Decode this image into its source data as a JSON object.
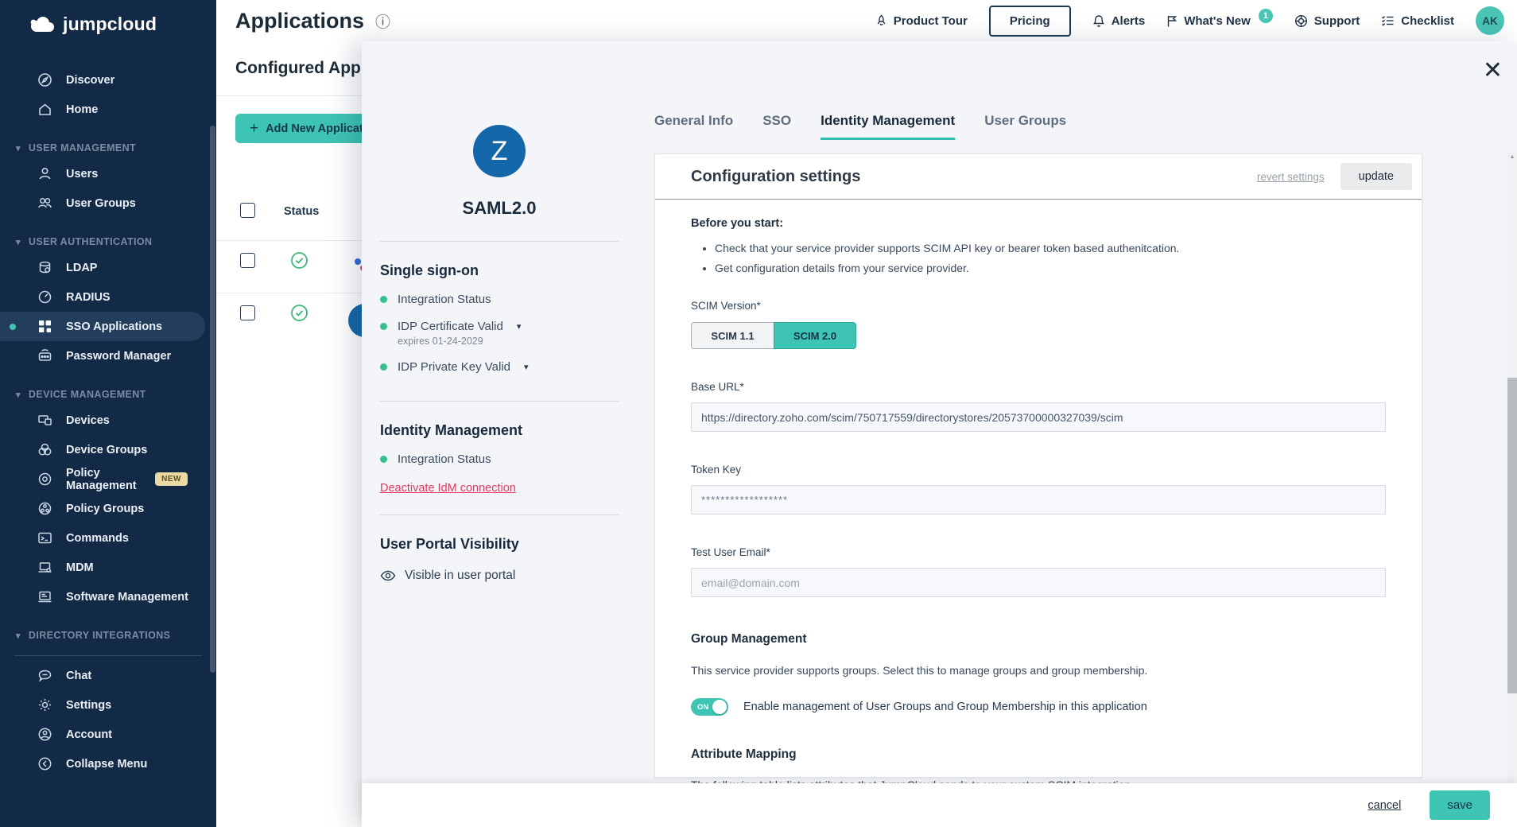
{
  "brand": {
    "name": "jumpcloud"
  },
  "topbar": {
    "title": "Applications",
    "product_tour": "Product Tour",
    "pricing": "Pricing",
    "alerts": "Alerts",
    "whats_new": "What's New",
    "whats_new_badge": "1",
    "support": "Support",
    "checklist": "Checklist",
    "avatar_initials": "AK"
  },
  "sidebar": {
    "top_items": [
      {
        "label": "Discover"
      },
      {
        "label": "Home"
      }
    ],
    "sections": [
      {
        "title": "USER MANAGEMENT",
        "items": [
          {
            "label": "Users"
          },
          {
            "label": "User Groups"
          }
        ]
      },
      {
        "title": "USER AUTHENTICATION",
        "items": [
          {
            "label": "LDAP"
          },
          {
            "label": "RADIUS"
          },
          {
            "label": "SSO Applications"
          },
          {
            "label": "Password Manager"
          }
        ]
      },
      {
        "title": "DEVICE MANAGEMENT",
        "items": [
          {
            "label": "Devices"
          },
          {
            "label": "Device Groups"
          },
          {
            "label": "Policy Management",
            "badge": "NEW"
          },
          {
            "label": "Policy Groups"
          },
          {
            "label": "Commands"
          },
          {
            "label": "MDM"
          },
          {
            "label": "Software Management"
          }
        ]
      },
      {
        "title": "DIRECTORY INTEGRATIONS",
        "items": []
      }
    ],
    "footer_items": [
      {
        "label": "Chat"
      },
      {
        "label": "Settings"
      },
      {
        "label": "Account"
      },
      {
        "label": "Collapse Menu"
      }
    ]
  },
  "page": {
    "heading": "Configured Applications",
    "add_button": "Add New Application",
    "status_header": "Status"
  },
  "drawer": {
    "app": {
      "initial": "Z",
      "name": "SAML2.0"
    },
    "sso": {
      "heading": "Single sign-on",
      "integration_status": "Integration Status",
      "certificate": "IDP Certificate Valid",
      "certificate_expiry": "expires 01-24-2029",
      "private_key": "IDP Private Key Valid"
    },
    "idm": {
      "heading": "Identity Management",
      "integration_status": "Integration Status",
      "deactivate_link": "Deactivate IdM connection"
    },
    "portal": {
      "heading": "User Portal Visibility",
      "visibility": "Visible in user portal"
    },
    "tabs": [
      {
        "label": "General Info"
      },
      {
        "label": "SSO"
      },
      {
        "label": "Identity Management"
      },
      {
        "label": "User Groups"
      }
    ],
    "config": {
      "title": "Configuration settings",
      "revert": "revert settings",
      "update": "update",
      "before_heading": "Before you start:",
      "bullets": [
        "Check that your service provider supports SCIM API key or bearer token based authenitcation.",
        "Get configuration details from your service provider."
      ],
      "scim_label": "SCIM Version*",
      "scim_options": [
        "SCIM 1.1",
        "SCIM 2.0"
      ],
      "scim_selected": "SCIM 2.0",
      "base_url_label": "Base URL*",
      "base_url_value": "https://directory.zoho.com/scim/750717559/directorystores/20573700000327039/scim",
      "token_label": "Token Key",
      "token_value": "******************",
      "email_label": "Test User Email*",
      "email_placeholder": "email@domain.com",
      "group_heading": "Group Management",
      "group_desc": "This service provider supports groups. Select this to manage groups and group membership.",
      "toggle_state": "ON",
      "toggle_label": "Enable management of User Groups and Group Membership in this application",
      "attr_heading": "Attribute Mapping",
      "attr_desc": "The following table lists attributes that JumpCloud sends to your custom SCIM integration."
    },
    "footer": {
      "cancel": "cancel",
      "save": "save"
    }
  },
  "icons": {
    "info": "ⓘ",
    "close": "✕",
    "caret_down": "▾",
    "plus": "+",
    "arrow_up": "▲",
    "arrow_down": "▼"
  },
  "colors": {
    "teal": "#3EC4B2",
    "navy": "#132A46",
    "green_status": "#35C08F",
    "red_link": "#E23A5F",
    "app_blue": "#1467A8"
  }
}
